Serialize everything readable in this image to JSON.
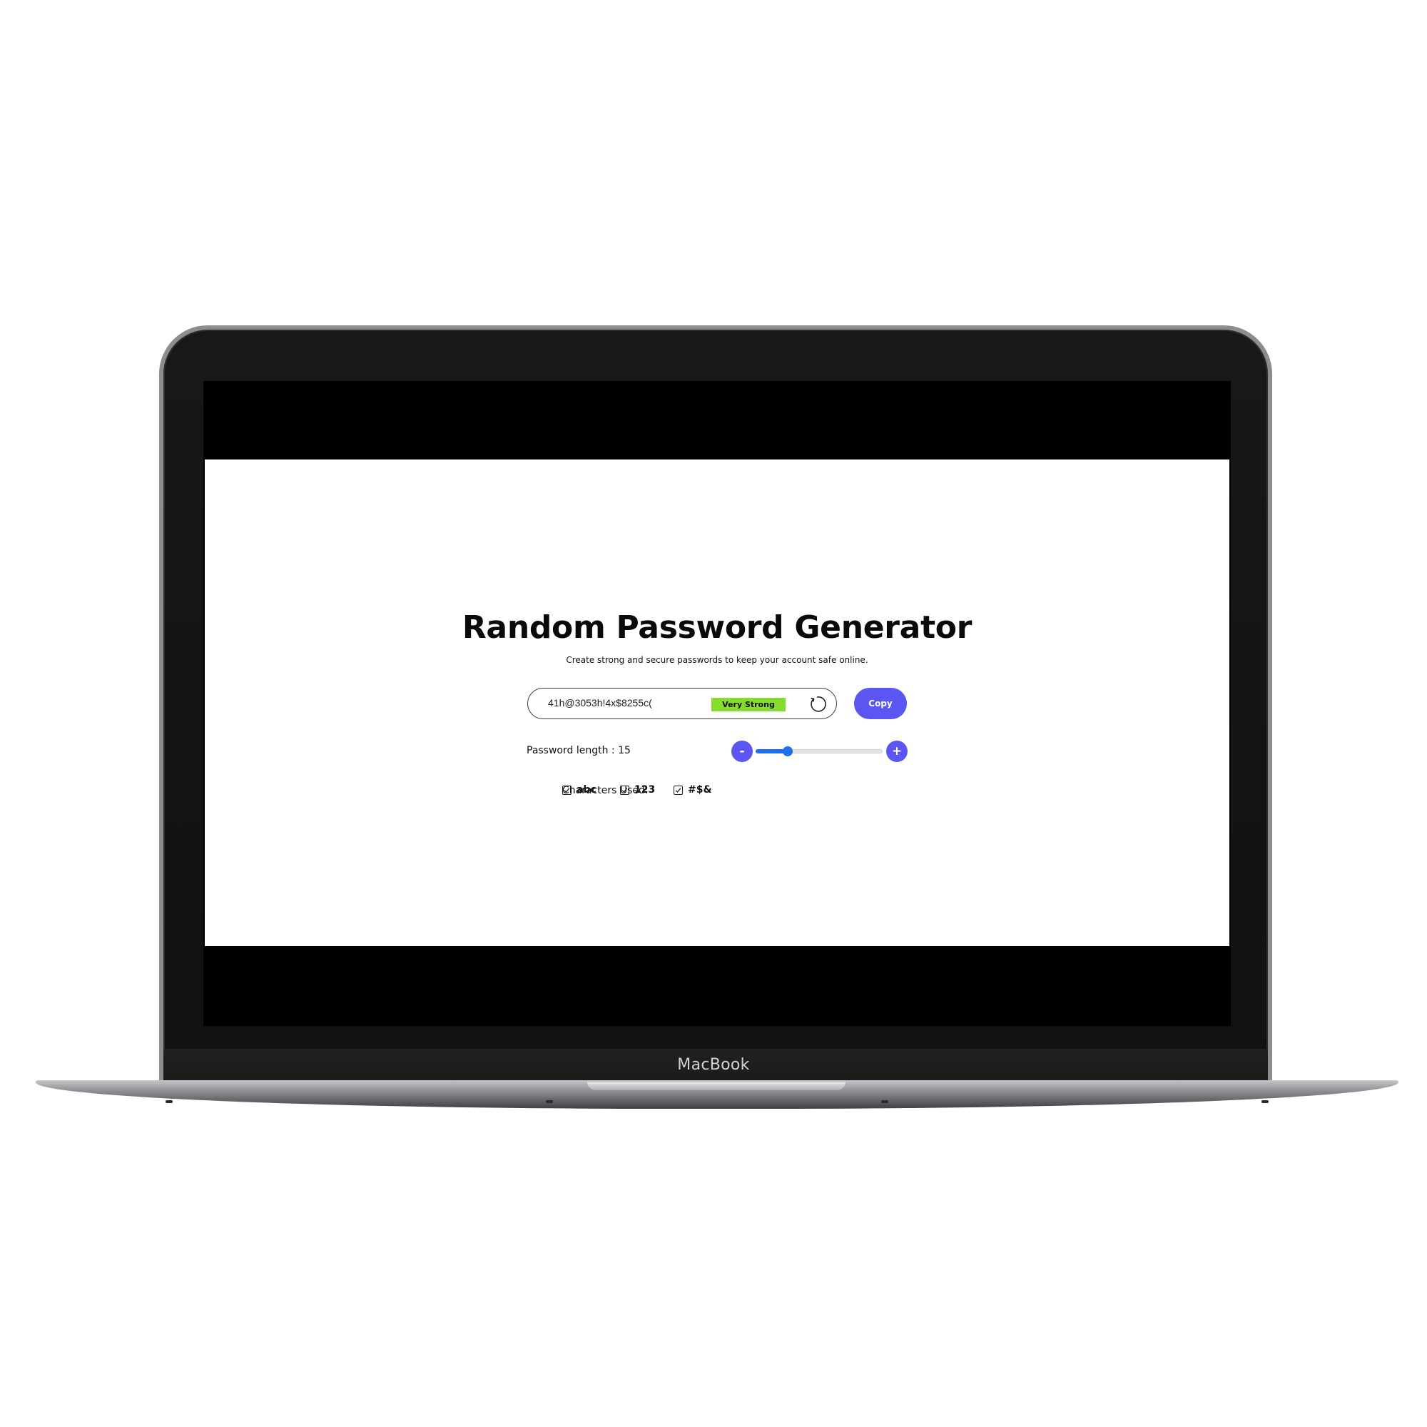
{
  "device": {
    "brand_label": "MacBook"
  },
  "app": {
    "title": "Random Password Generator",
    "subtitle": "Create strong and secure passwords to keep your account safe online.",
    "password": {
      "value": "41h@3053h!4x$8255c(",
      "strength_label": "Very Strong",
      "strength_color": "#86dd2e"
    },
    "copy_button_label": "Copy",
    "length": {
      "label": "Password length : 15",
      "value": 15,
      "slider_fraction": 0.25,
      "minus_label": "-",
      "plus_label": "+"
    },
    "characters": {
      "label": "Characters Used:",
      "options": [
        {
          "label": "abc",
          "checked": true
        },
        {
          "label": "123",
          "checked": true
        },
        {
          "label": "#$&",
          "checked": true
        }
      ]
    },
    "colors": {
      "accent": "#5b56f2",
      "slider": "#1f6feb"
    },
    "icons": [
      "refresh-icon",
      "check-icon"
    ]
  }
}
